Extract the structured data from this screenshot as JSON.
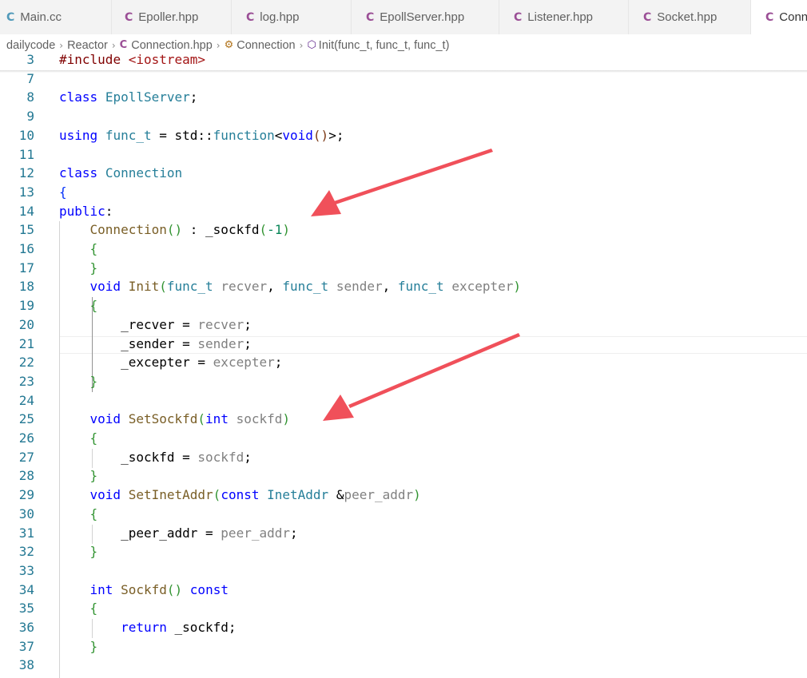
{
  "tabs": [
    {
      "label": "Main.cc",
      "icon": "cpp-file-icon"
    },
    {
      "label": "Epoller.hpp",
      "icon": "cpp-file-icon"
    },
    {
      "label": "log.hpp",
      "icon": "cpp-file-icon"
    },
    {
      "label": "EpollServer.hpp",
      "icon": "cpp-file-icon"
    },
    {
      "label": "Listener.hpp",
      "icon": "cpp-file-icon"
    },
    {
      "label": "Socket.hpp",
      "icon": "cpp-file-icon"
    },
    {
      "label": "Conn",
      "icon": "cpp-file-icon"
    }
  ],
  "breadcrumb": {
    "folder1": "dailycode",
    "folder2": "Reactor",
    "file": "Connection.hpp",
    "class": "Connection",
    "method": "Init(func_t, func_t, func_t)"
  },
  "editor": {
    "line_numbers": [
      "3",
      "7",
      "8",
      "9",
      "10",
      "11",
      "12",
      "13",
      "14",
      "15",
      "16",
      "17",
      "18",
      "19",
      "20",
      "21",
      "22",
      "23",
      "24",
      "25",
      "26",
      "27",
      "28",
      "29",
      "30",
      "31",
      "32",
      "33",
      "34",
      "35",
      "36",
      "37",
      "38"
    ],
    "lines": [
      [
        "#",
        "include",
        " ",
        "<iostream>"
      ],
      [],
      [
        "class",
        " ",
        "EpollServer",
        ";"
      ],
      [],
      [
        "using",
        " ",
        "func_t",
        " = std::",
        "function",
        "<",
        "void",
        "(",
        ")",
        ">;"
      ],
      [],
      [
        "class",
        " ",
        "Connection"
      ],
      [
        "{"
      ],
      [
        "public",
        ":"
      ],
      [
        "    ",
        "Connection",
        "(",
        ")",
        " : _sockfd",
        "(",
        "-1",
        ")"
      ],
      [
        "    ",
        "{"
      ],
      [
        "    ",
        "}"
      ],
      [
        "    ",
        "void",
        " ",
        "Init",
        "(",
        "func_t",
        " ",
        "recver",
        ", ",
        "func_t",
        " ",
        "sender",
        ", ",
        "func_t",
        " ",
        "excepter",
        ")"
      ],
      [
        "    ",
        "{"
      ],
      [
        "        ",
        "_recver",
        " = ",
        "recver",
        ";"
      ],
      [
        "        ",
        "_sender",
        " = ",
        "sender",
        ";"
      ],
      [
        "        ",
        "_excepter",
        " = ",
        "excepter",
        ";"
      ],
      [
        "    ",
        "}"
      ],
      [],
      [
        "    ",
        "void",
        " ",
        "SetSockfd",
        "(",
        "int",
        " ",
        "sockfd",
        ")"
      ],
      [
        "    ",
        "{"
      ],
      [
        "        ",
        "_sockfd",
        " = ",
        "sockfd",
        ";"
      ],
      [
        "    ",
        "}"
      ],
      [
        "    ",
        "void",
        " ",
        "SetInetAddr",
        "(",
        "const",
        " ",
        "InetAddr",
        " &",
        "peer_addr",
        ")"
      ],
      [
        "    ",
        "{"
      ],
      [
        "        ",
        "_peer_addr",
        " = ",
        "peer_addr",
        ";"
      ],
      [
        "    ",
        "}"
      ],
      [],
      [
        "    ",
        "int",
        " ",
        "Sockfd",
        "(",
        ")",
        " ",
        "const"
      ],
      [
        "    ",
        "{"
      ],
      [
        "        ",
        "return",
        " _sockfd;"
      ],
      [
        "    ",
        "}"
      ],
      []
    ]
  },
  "annotations": {
    "arrow_color": "#f0505a"
  }
}
